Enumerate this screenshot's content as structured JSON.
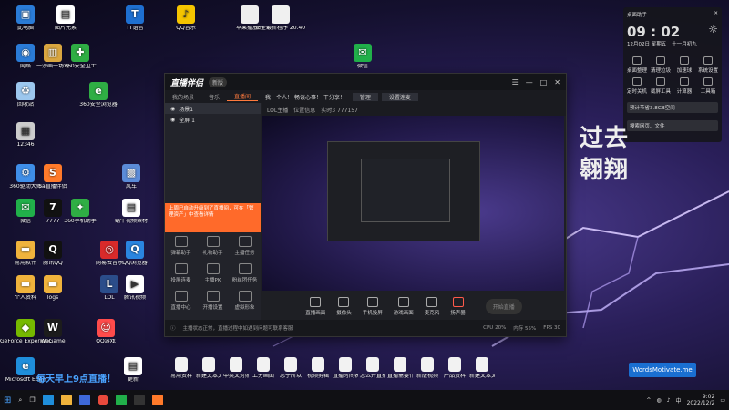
{
  "desktop": {
    "icons": [
      {
        "label": "此电脑",
        "color": "#2a7bd6",
        "glyph": "▣"
      },
      {
        "label": "图片元素",
        "color": "#ffffff",
        "glyph": "▤"
      },
      {
        "label": "TT语音",
        "color": "#1e6fd0",
        "glyph": "T"
      },
      {
        "label": "QQ音乐",
        "color": "#f5c400",
        "glyph": "♪"
      },
      {
        "label": "网络",
        "color": "#2a7bd6",
        "glyph": "◉"
      },
      {
        "label": "一沙画一场戏",
        "color": "#d9a640",
        "glyph": "▥"
      },
      {
        "label": "360安全卫士",
        "color": "#2fae44",
        "glyph": "✚"
      },
      {
        "label": "微信",
        "color": "#21b04a",
        "glyph": "✉"
      },
      {
        "label": "回收站",
        "color": "#9cc7ee",
        "glyph": "♻"
      },
      {
        "label": "360安全浏览器",
        "color": "#2fae44",
        "glyph": "e"
      },
      {
        "label": "12346",
        "color": "#cccccc",
        "glyph": "▦"
      },
      {
        "label": "360驱动大师",
        "color": "#3f8ee8",
        "glyph": "⚙"
      },
      {
        "label": "Sa直播伴侣",
        "color": "#ff7a2a",
        "glyph": "S"
      },
      {
        "label": "风车",
        "color": "#5b8bd8",
        "glyph": "▩"
      },
      {
        "label": "微信",
        "color": "#21b04a",
        "glyph": "✉"
      },
      {
        "label": "7777",
        "color": "#111111",
        "glyph": "7"
      },
      {
        "label": "360手机助手",
        "color": "#2fae44",
        "glyph": "✦"
      },
      {
        "label": "蜗牛视频素材",
        "color": "#ffffff",
        "glyph": "▤"
      },
      {
        "label": "常用软件",
        "color": "#f0b33c",
        "glyph": "▬"
      },
      {
        "label": "腾讯QQ",
        "color": "#111111",
        "glyph": "Q"
      },
      {
        "label": "网易云音乐",
        "color": "#d82a2a",
        "glyph": "◎"
      },
      {
        "label": "QQ浏览器",
        "color": "#2a85e0",
        "glyph": "Q"
      },
      {
        "label": "个人资料",
        "color": "#f0b33c",
        "glyph": "▬"
      },
      {
        "label": "logs",
        "color": "#f0b33c",
        "glyph": "▬"
      },
      {
        "label": "LOL",
        "color": "#2b4d8a",
        "glyph": "L"
      },
      {
        "label": "腾讯视频",
        "color": "#ffffff",
        "glyph": "▶"
      },
      {
        "label": "GeForce Experience",
        "color": "#76b900",
        "glyph": "◆"
      },
      {
        "label": "WeGame",
        "color": "#1c1c1c",
        "glyph": "W"
      },
      {
        "label": "QQ游戏",
        "color": "#ff4b4b",
        "glyph": "☺"
      },
      {
        "label": "Microsoft Edge",
        "color": "#1f8edb",
        "glyph": "e"
      },
      {
        "label": "更新",
        "color": "#ffffff",
        "glyph": "▤"
      }
    ],
    "top_files": [
      {
        "label": "苹果播放的"
      },
      {
        "label": "安全最新程序 20.40 1.1.11"
      }
    ],
    "bottom_files": [
      "常用资料",
      "新建文本文档",
      "中英文对照表",
      "上分画面",
      "忘乎所以",
      "视频剪辑",
      "直播时间表",
      "怎么开直播",
      "直播需要什么",
      "新版视频",
      "产品资料",
      "新建文本文档"
    ],
    "big_text_1": "过去",
    "big_text_2": "翱翔",
    "caption": "每天早上9点直播！",
    "motivate": "WordsMotivate.me"
  },
  "app": {
    "logo": "直播伴侣",
    "version": "新版",
    "tabs": [
      "我的场景",
      "音乐",
      "直播间"
    ],
    "active_tab": "直播间",
    "header_title": "我一个人！ 畅谈心事！ 干分享！",
    "header_buttons": [
      "管理",
      "设置连麦"
    ],
    "sub_header": [
      "LOL主播",
      "位置信息",
      "实时3 777157"
    ],
    "scenes": [
      {
        "label": "场景1",
        "selected": true
      },
      {
        "label": "全屏 1",
        "selected": false
      }
    ],
    "notice": "上周已自动升级到了直播间，可在「管理资产」中查看详情",
    "tools": [
      "弹幕助手",
      "礼物助手",
      "主播任务",
      "投屏连麦",
      "主播PK",
      "粉丝团任务",
      "直播中心",
      "开播设置",
      "虚拟形象"
    ],
    "bottom_tools": [
      "直播画面",
      "摄像头",
      "手机投屏",
      "游戏画面",
      "麦克风",
      "扬声器"
    ],
    "start_live": "开始直播",
    "status_left": "主播状态正常，直播过程中如遇到问题可联系客服",
    "status_right": [
      "CPU 20%",
      "内存 55%",
      "FPS 30"
    ]
  },
  "widget": {
    "title": "桌面助手",
    "clock": "09 : 02",
    "date": "12月02日 星期五",
    "lunar": "十一月初九",
    "shortcuts": [
      "桌面整理",
      "清理垃圾",
      "加速球",
      "系统设置",
      "定时关机",
      "截屏工具",
      "计算器",
      "工具箱"
    ],
    "search_placeholder": "搜索网页、文件",
    "notice": "预计节省3.8GB空间"
  },
  "taskbar": {
    "search_placeholder": "",
    "apps": [
      "start",
      "search",
      "task-view",
      "edge",
      "explorer",
      "store",
      "chrome",
      "wechat",
      "qq",
      "live-companion"
    ],
    "time": "9:02",
    "date": "2022/12/2",
    "lang": "中"
  }
}
